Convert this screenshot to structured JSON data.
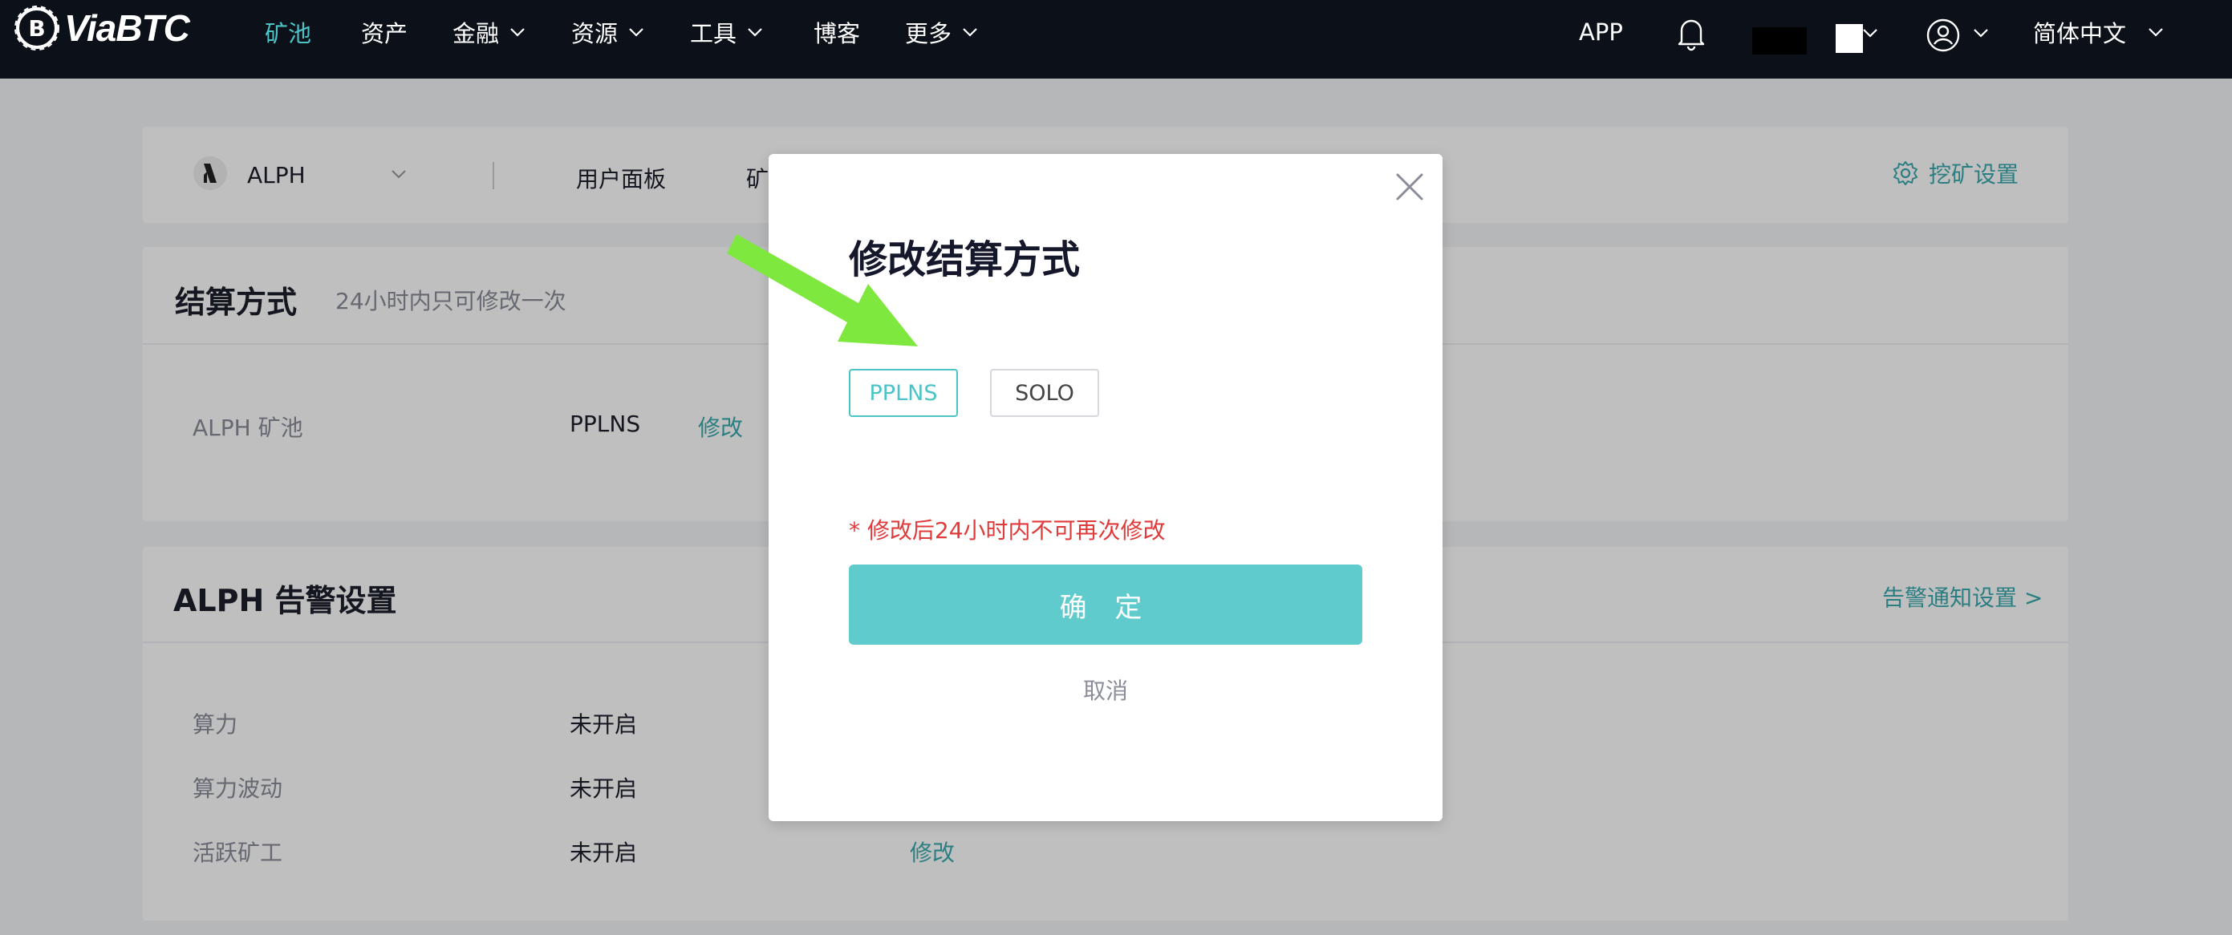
{
  "brand": {
    "name": "ViaBTC"
  },
  "nav": {
    "items": [
      {
        "label": "矿池",
        "active": true,
        "dropdown": false
      },
      {
        "label": "资产",
        "active": false,
        "dropdown": false
      },
      {
        "label": "金融",
        "active": false,
        "dropdown": true
      },
      {
        "label": "资源",
        "active": false,
        "dropdown": true
      },
      {
        "label": "工具",
        "active": false,
        "dropdown": true
      },
      {
        "label": "博客",
        "active": false,
        "dropdown": false
      },
      {
        "label": "更多",
        "active": false,
        "dropdown": true
      }
    ],
    "app_label": "APP",
    "language": "简体中文",
    "icons": [
      "bell-icon",
      "user-circle-icon",
      "chevron-down-icon"
    ]
  },
  "coin_bar": {
    "coin": "ALPH",
    "tabs": [
      "用户面板",
      "矿"
    ],
    "settings_label": "挖矿设置"
  },
  "settlement": {
    "title": "结算方式",
    "note": "24小时内只可修改一次",
    "row": {
      "label": "ALPH 矿池",
      "value": "PPLNS",
      "action": "修改"
    }
  },
  "alerts": {
    "title": "ALPH 告警设置",
    "link": "告警通知设置 >",
    "rows": [
      {
        "label": "算力",
        "value": "未开启",
        "action": ""
      },
      {
        "label": "算力波动",
        "value": "未开启",
        "action": ""
      },
      {
        "label": "活跃矿工",
        "value": "未开启",
        "action": "修改"
      }
    ]
  },
  "modal": {
    "title": "修改结算方式",
    "options": [
      {
        "label": "PPLNS",
        "selected": true
      },
      {
        "label": "SOLO",
        "selected": false
      }
    ],
    "warning": "* 修改后24小时内不可再次修改",
    "confirm": "确 定",
    "cancel": "取消"
  },
  "colors": {
    "accent": "#4cc3c7",
    "confirm_bg": "#5fcbcd",
    "warning": "#e03a3a",
    "nav_bg": "#0c1019",
    "annotation_arrow": "#7ee83f"
  }
}
